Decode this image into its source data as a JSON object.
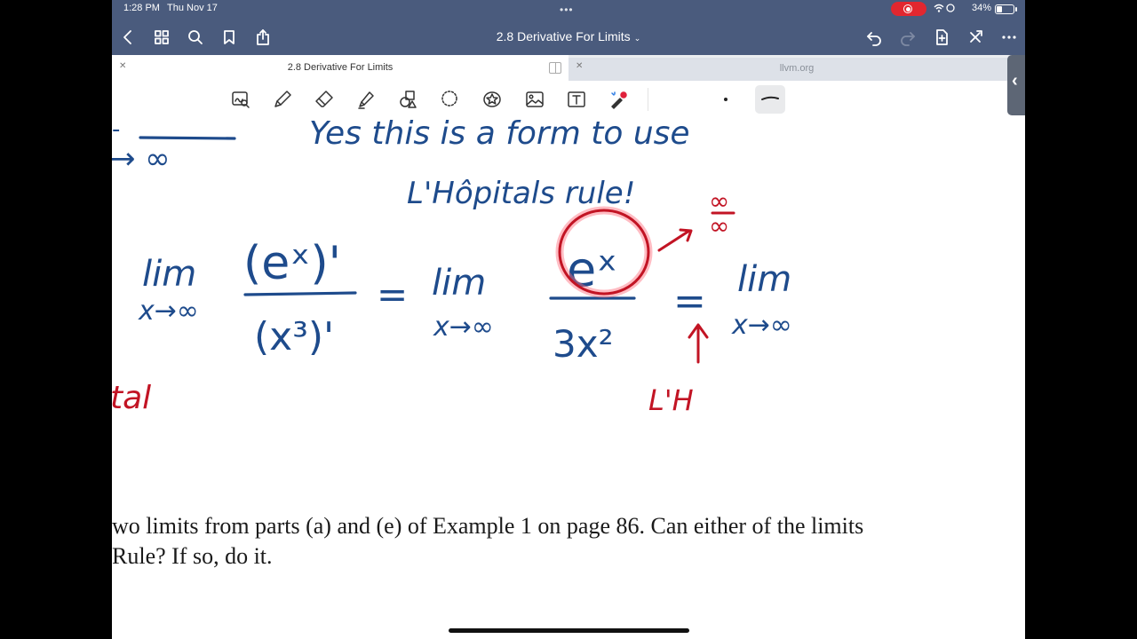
{
  "status_bar": {
    "time": "1:28 PM",
    "date": "Thu Nov 17",
    "battery": "34%",
    "battery_level": 0.34
  },
  "nav": {
    "title": "2.8 Derivative For Limits",
    "buttons": [
      "back-icon",
      "grid-icon",
      "search-icon",
      "bookmark-icon",
      "share-icon",
      "undo-icon",
      "redo-icon",
      "add-page-icon",
      "close-tools-icon",
      "more-icon"
    ]
  },
  "tabs": [
    {
      "label": "2.8 Derivative For Limits",
      "active": true
    },
    {
      "label": "llvm.org",
      "active": false
    }
  ],
  "toolbar": {
    "tools": [
      "zoom-write-icon",
      "pen-icon",
      "eraser-icon",
      "highlighter-icon",
      "shapes-icon",
      "lasso-icon",
      "sticker-icon",
      "image-icon",
      "text-icon",
      "laser-pointer-icon"
    ]
  },
  "colors": {
    "nav": "#4a5b7d",
    "ink_blue": "#1e4b8c",
    "ink_red": "#c21424"
  },
  "notes": {
    "line1": "Yes this is a form to use",
    "line2": "L'Hôpitals rule!",
    "lim": "lim",
    "sub": "x→∞",
    "num1": "(eˣ)'",
    "den1": "(x³)'",
    "equals": "=",
    "num2": "eˣ",
    "den2": "3x²",
    "red_frac_top": "∞",
    "red_frac_bot": "∞",
    "red_label": "L'H",
    "partial_left": "tal",
    "partial_inf": "→ ∞"
  },
  "document_text": {
    "line1": "wo limits from parts (a) and (e) of Example 1 on page 86. Can either of the limits",
    "line2": "Rule? If so, do it."
  }
}
